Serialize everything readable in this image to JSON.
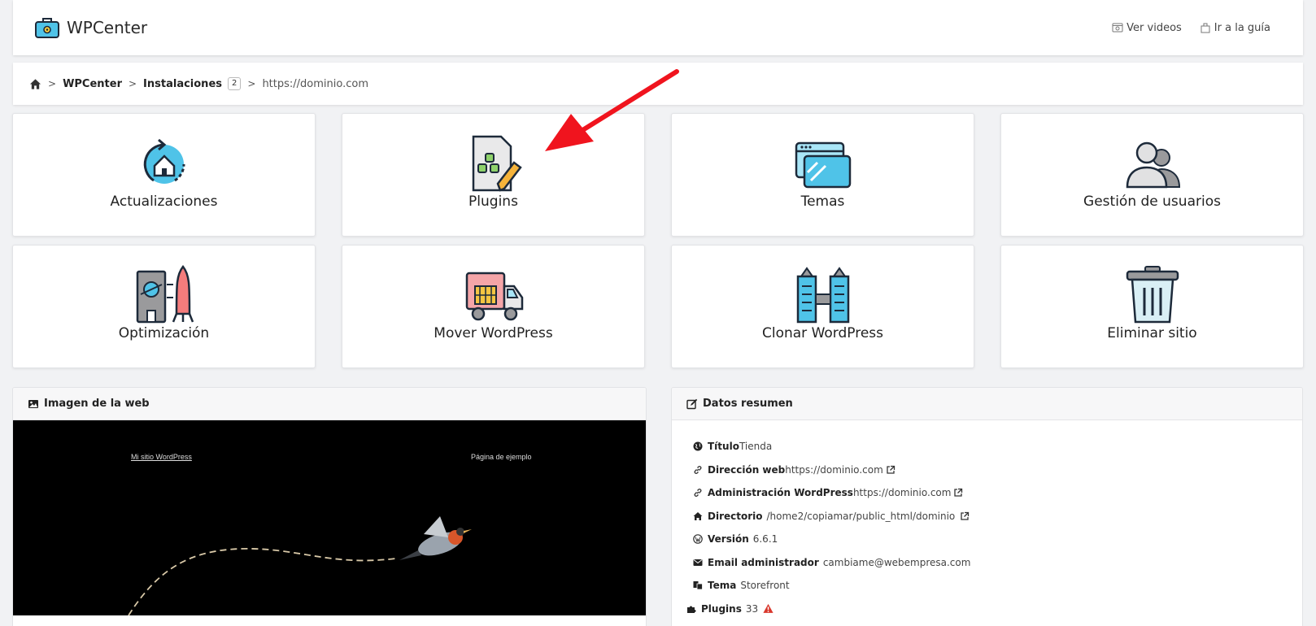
{
  "header": {
    "app_name": "WPCenter",
    "links": [
      {
        "label": "Ver videos",
        "icon": "video-icon"
      },
      {
        "label": "Ir a la guía",
        "icon": "guide-icon"
      }
    ]
  },
  "breadcrumb": {
    "home_icon": "home-icon",
    "items": [
      "WPCenter",
      "Instalaciones"
    ],
    "installations_count": "2",
    "current": "https://dominio.com"
  },
  "tiles": [
    {
      "label": "Actualizaciones",
      "icon": "update-icon"
    },
    {
      "label": "Plugins",
      "icon": "plugins-icon"
    },
    {
      "label": "Temas",
      "icon": "themes-icon"
    },
    {
      "label": "Gestión de usuarios",
      "icon": "users-icon"
    },
    {
      "label": "Optimización",
      "icon": "optimization-icon"
    },
    {
      "label": "Mover WordPress",
      "icon": "truck-icon"
    },
    {
      "label": "Clonar WordPress",
      "icon": "clone-icon"
    },
    {
      "label": "Eliminar sitio",
      "icon": "trash-icon"
    }
  ],
  "preview_panel": {
    "title": "Imagen de la web",
    "site_title_link": "Mi sitio WordPress",
    "sample_page_link": "Página de ejemplo"
  },
  "summary_panel": {
    "title": "Datos resumen",
    "rows": [
      {
        "key": "Título",
        "value": "Tienda",
        "icon": "globe-icon"
      },
      {
        "key": "Dirección web",
        "value": "https://dominio.com",
        "icon": "link-icon"
      },
      {
        "key": "Administración WordPress",
        "value": "https://dominio.com",
        "icon": "link-icon"
      },
      {
        "key": "Directorio",
        "value": "/home2/copiamar/public_html/dominio",
        "icon": "home-icon"
      },
      {
        "key": "Versión",
        "value": "6.6.1",
        "icon": "wordpress-icon"
      },
      {
        "key": "Email administrador",
        "value": "cambiame@webempresa.com",
        "icon": "envelope-icon"
      },
      {
        "key": "Tema",
        "value": "Storefront",
        "icon": "theme-icon"
      },
      {
        "key": "Plugins",
        "value": "33",
        "icon": "puzzle-icon"
      }
    ]
  },
  "colors": {
    "accent_blue": "#4fc3e8",
    "arrow_red": "#f0141e",
    "warning_red": "#d9362b"
  }
}
